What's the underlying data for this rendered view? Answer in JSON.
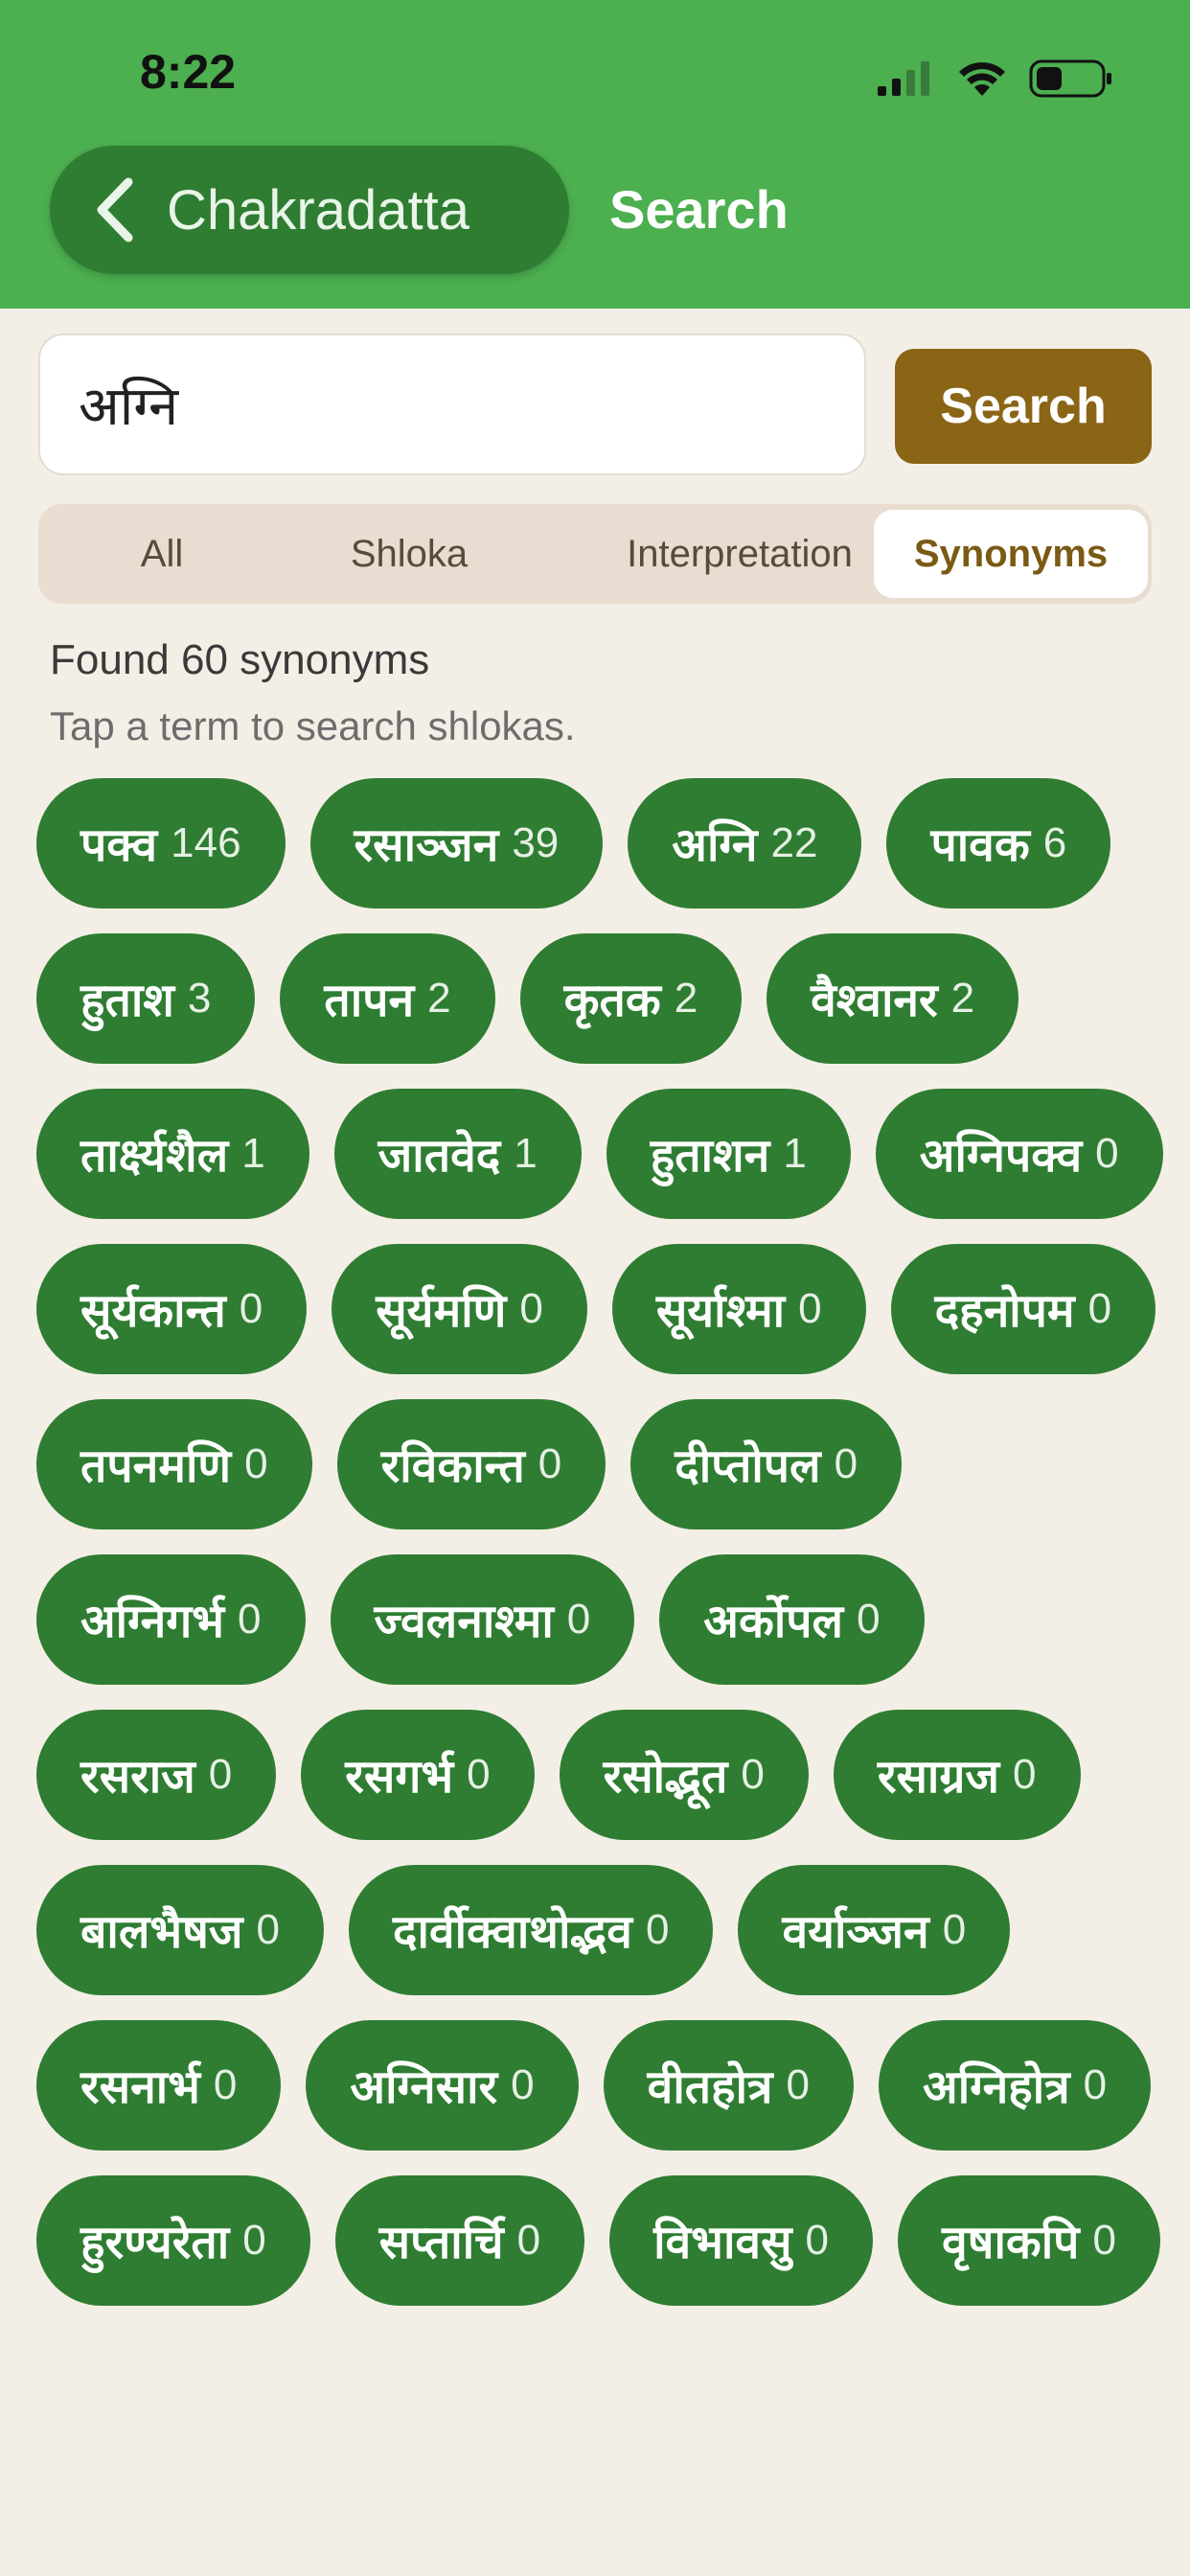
{
  "status": {
    "time": "8:22"
  },
  "nav": {
    "back_label": "Chakradatta",
    "title": "Search"
  },
  "search": {
    "value": "अग्नि",
    "button_label": "Search"
  },
  "tabs": [
    {
      "label": "All",
      "active": false
    },
    {
      "label": "Shloka",
      "active": false
    },
    {
      "label": "Interpretation",
      "active": false
    },
    {
      "label": "Synonyms",
      "active": true
    }
  ],
  "results": {
    "found_text": "Found 60 synonyms",
    "hint_text": "Tap a term to search shlokas."
  },
  "colors": {
    "header": "#4caf50",
    "chip": "#2e7d32",
    "search_button": "#8a6516",
    "background": "#f4efe6"
  },
  "synonyms": [
    {
      "term": "पक्व",
      "count": "146"
    },
    {
      "term": "रसाञ्जन",
      "count": "39"
    },
    {
      "term": "अग्नि",
      "count": "22"
    },
    {
      "term": "पावक",
      "count": "6"
    },
    {
      "term": "हुताश",
      "count": "3"
    },
    {
      "term": "तापन",
      "count": "2"
    },
    {
      "term": "कृतक",
      "count": "2"
    },
    {
      "term": "वैश्वानर",
      "count": "2"
    },
    {
      "term": "तार्क्ष्यशैल",
      "count": "1"
    },
    {
      "term": "जातवेद",
      "count": "1"
    },
    {
      "term": "हुताशन",
      "count": "1"
    },
    {
      "term": "अग्निपक्व",
      "count": "0"
    },
    {
      "term": "सूर्यकान्त",
      "count": "0"
    },
    {
      "term": "सूर्यमणि",
      "count": "0"
    },
    {
      "term": "सूर्याश्मा",
      "count": "0"
    },
    {
      "term": "दहनोपम",
      "count": "0"
    },
    {
      "term": "तपनमणि",
      "count": "0"
    },
    {
      "term": "रविकान्त",
      "count": "0"
    },
    {
      "term": "दीप्तोपल",
      "count": "0"
    },
    {
      "term": "अग्निगर्भ",
      "count": "0"
    },
    {
      "term": "ज्वलनाश्मा",
      "count": "0"
    },
    {
      "term": "अर्कोपल",
      "count": "0"
    },
    {
      "term": "रसराज",
      "count": "0"
    },
    {
      "term": "रसगर्भ",
      "count": "0"
    },
    {
      "term": "रसोद्भूत",
      "count": "0"
    },
    {
      "term": "रसाग्रज",
      "count": "0"
    },
    {
      "term": "बालभैषज",
      "count": "0"
    },
    {
      "term": "दार्वीक्वाथोद्भव",
      "count": "0"
    },
    {
      "term": "वर्याञ्जन",
      "count": "0"
    },
    {
      "term": "रसनार्भ",
      "count": "0"
    },
    {
      "term": "अग्निसार",
      "count": "0"
    },
    {
      "term": "वीतहोत्र",
      "count": "0"
    },
    {
      "term": "अग्निहोत्र",
      "count": "0"
    },
    {
      "term": "हुरण्यरेता",
      "count": "0"
    },
    {
      "term": "सप्तार्चि",
      "count": "0"
    },
    {
      "term": "विभावसु",
      "count": "0"
    },
    {
      "term": "वृषाकपि",
      "count": "0"
    }
  ]
}
